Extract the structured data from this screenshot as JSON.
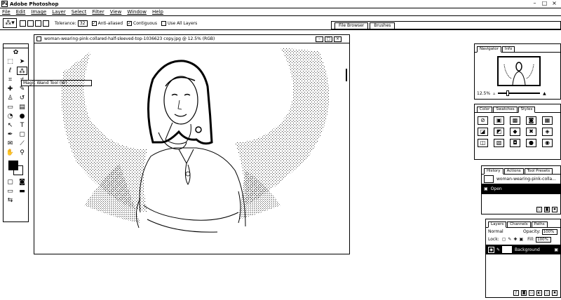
{
  "window": {
    "app_title": "Adobe Photoshop",
    "app_icon": "Ps"
  },
  "window_controls": {
    "minimize": "–",
    "maximize": "□",
    "close": "×"
  },
  "menu": [
    "File",
    "Edit",
    "Image",
    "Layer",
    "Select",
    "Filter",
    "View",
    "Window",
    "Help"
  ],
  "options_bar": {
    "tool_icon": "magic-wand-icon",
    "tolerance_label": "Tolerance:",
    "tolerance_value": "32",
    "anti_aliased_label": "Anti-aliased",
    "anti_aliased_checked": true,
    "contiguous_label": "Contiguous",
    "contiguous_checked": true,
    "use_all_layers_label": "Use All Layers",
    "use_all_layers_checked": false
  },
  "palette_well": {
    "tabs": [
      "File Browser",
      "Brushes"
    ]
  },
  "tooltip": "Magic Wand Tool (W)",
  "document": {
    "title": "woman-wearing-pink-collared-half-sleeved-top-1036623 copy.jpg @ 12.5% (RGB)"
  },
  "navigator": {
    "tabs": [
      "Navigator",
      "Info"
    ],
    "active_tab": "Navigator",
    "zoom_value": "12.5%"
  },
  "styles_panel": {
    "tabs": [
      "Color",
      "Swatches",
      "Styles"
    ],
    "active_tab": "Styles",
    "styles": [
      "⊘",
      "▣",
      "▩",
      "◙",
      "▦",
      "◪",
      "◩",
      "◆",
      "✖",
      "◈",
      "◫",
      "▧",
      "◘",
      "●",
      "◉"
    ]
  },
  "history_panel": {
    "tabs": [
      "History",
      "Actions",
      "Tool Presets"
    ],
    "active_tab": "History",
    "snapshot_label": "woman-wearing-pink-colla...",
    "states": [
      "Open"
    ]
  },
  "layers_panel": {
    "tabs": [
      "Layers",
      "Channels",
      "Paths"
    ],
    "active_tab": "Layers",
    "blend_mode": "Normal",
    "opacity_label": "Opacity:",
    "opacity_value": "100%",
    "lock_label": "Lock:",
    "fill_label": "Fill:",
    "fill_value": "100%",
    "layers": [
      {
        "name": "Background"
      }
    ]
  }
}
